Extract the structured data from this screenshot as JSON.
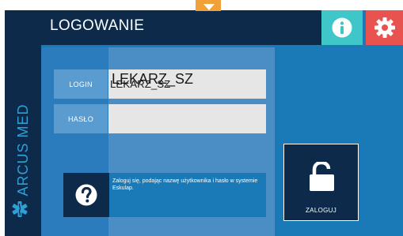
{
  "header": {
    "title": "LOGOWANIE"
  },
  "brand": {
    "name": "ARCUS MED"
  },
  "form": {
    "login_label": "LOGIN",
    "login_value": "LEKARZ_SZ",
    "password_label": "HASŁO",
    "password_value": ""
  },
  "help": {
    "text": "Zaloguj się, podając nazwę użytkownika i hasło w systemie Eskulap."
  },
  "actions": {
    "login_label": "ZALOGUJ"
  },
  "icons": {
    "info": "info-icon",
    "settings": "gear-icon",
    "help": "question-icon",
    "unlock": "unlock-icon",
    "brand": "medical-star-icon",
    "pin": "dropdown-arrow-icon"
  },
  "colors": {
    "navy": "#0d2a4a",
    "blue": "#1a7ab8",
    "panel": "#4a8ec5",
    "teal": "#3fc6c8",
    "red": "#e9534f",
    "orange": "#f1a137",
    "brand": "#2f9fd6"
  }
}
